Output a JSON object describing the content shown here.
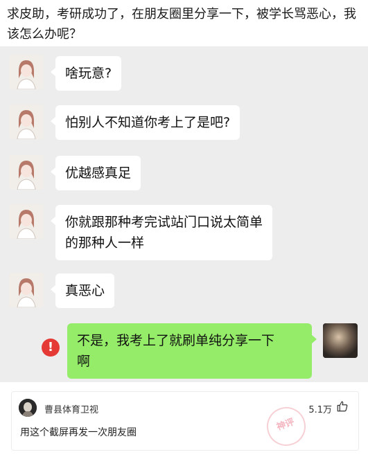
{
  "post": {
    "title": "求皮助，考研成功了，在朋友圈里分享一下，被学长骂恶心，我该怎么办呢？"
  },
  "chat": {
    "messages": [
      {
        "from": "other",
        "text_lines": [
          "啥玩意?"
        ]
      },
      {
        "from": "other",
        "text_lines": [
          "怕别人不知道你考上了是吧?"
        ]
      },
      {
        "from": "other",
        "text_lines": [
          "优越感真足"
        ]
      },
      {
        "from": "other",
        "text_lines": [
          "你就跟那种考完试站门口说太简单",
          "的那种人一样"
        ]
      },
      {
        "from": "other",
        "text_lines": [
          "真恶心"
        ]
      },
      {
        "from": "me",
        "text_lines": [
          "不是，我考上了就刷单纯分享一下",
          "啊"
        ],
        "status": "send-failed"
      }
    ],
    "error_symbol": "!",
    "colors": {
      "background": "#ededed",
      "my_bubble": "#95ec69",
      "error": "#e53935"
    }
  },
  "comment": {
    "user_name": "曹县体育卫视",
    "likes": "5.1万",
    "text": "用这个截屏再发一次朋友圈",
    "stamp_text": "神评",
    "thumb_icon": "thumbs-up-icon"
  }
}
